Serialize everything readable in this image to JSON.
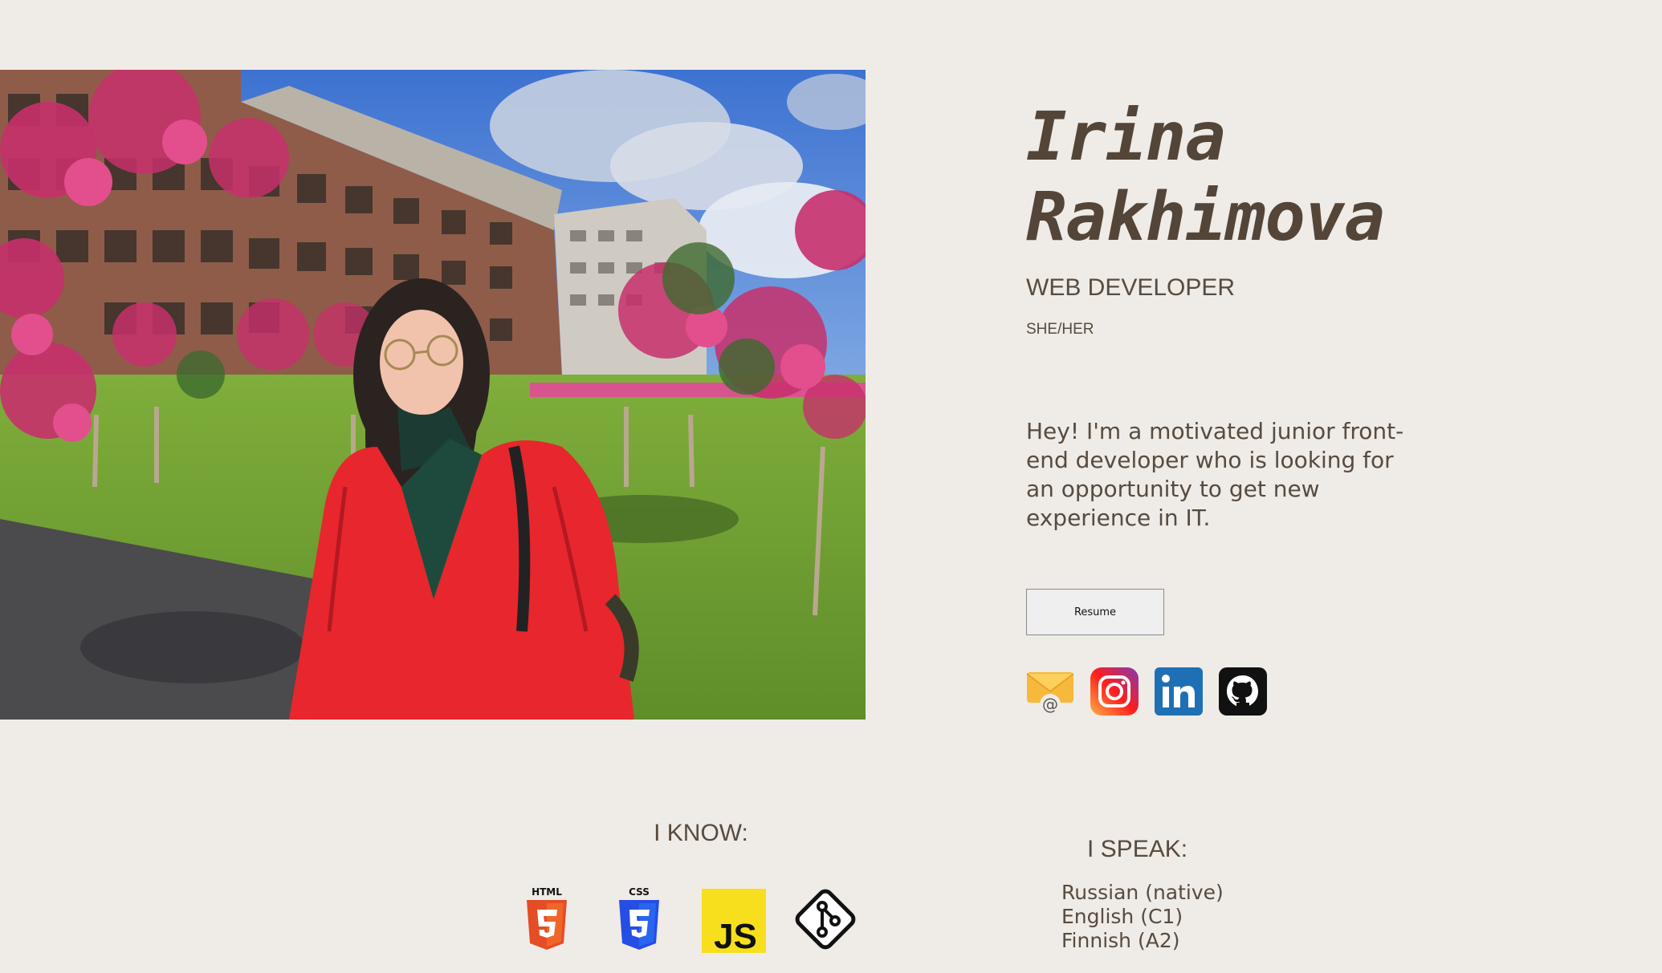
{
  "profile": {
    "first_name": "Irina",
    "last_name": "Rakhimova",
    "role": "WEB DEVELOPER",
    "pronouns": "SHE/HER",
    "bio": "Hey! I'm a motivated junior front-end developer who is looking for an opportunity to get new experience in IT.",
    "resume_label": "Resume"
  },
  "social": [
    {
      "name": "email",
      "icon": "mail-icon"
    },
    {
      "name": "instagram",
      "icon": "instagram-icon"
    },
    {
      "name": "linkedin",
      "icon": "linkedin-icon"
    },
    {
      "name": "github",
      "icon": "github-icon"
    }
  ],
  "skills_section": {
    "title": "I KNOW:",
    "items": [
      {
        "name": "HTML",
        "label": "HTML",
        "icon": "html5-icon",
        "color": "#e44d26"
      },
      {
        "name": "CSS",
        "label": "CSS",
        "icon": "css3-icon",
        "color": "#264de4"
      },
      {
        "name": "JavaScript",
        "label": "JS",
        "icon": "javascript-icon",
        "color": "#f7df1e"
      },
      {
        "name": "Git",
        "icon": "git-icon",
        "color": "#000000"
      }
    ]
  },
  "languages_section": {
    "title": "I SPEAK:",
    "items": [
      "Russian (native)",
      "English (C1)",
      "Finnish (A2)"
    ]
  },
  "colors": {
    "background": "#efebe6",
    "text": "#574b3f",
    "jacket": "#e8262d"
  }
}
